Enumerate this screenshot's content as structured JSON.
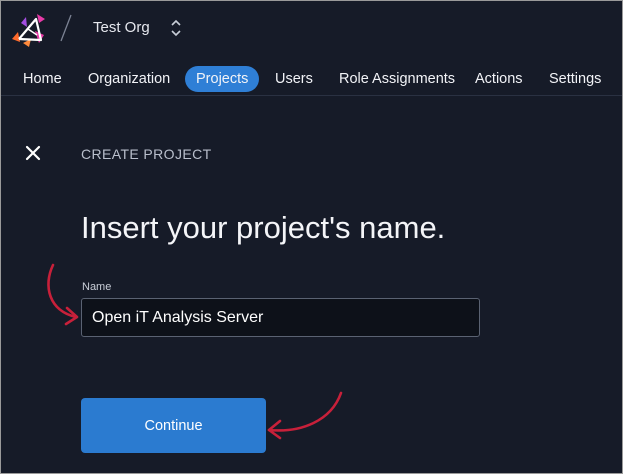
{
  "header": {
    "org_name": "Test Org",
    "brand_colors": [
      "#ff6a2b",
      "#e83aa8",
      "#a34ee0",
      "#ffffff"
    ],
    "icons": [
      "logo-icon",
      "org-switcher-icon"
    ]
  },
  "nav": {
    "items": [
      {
        "label": "Home",
        "active": false
      },
      {
        "label": "Organization",
        "active": false
      },
      {
        "label": "Projects",
        "active": true
      },
      {
        "label": "Users",
        "active": false
      },
      {
        "label": "Role Assignments",
        "active": false
      },
      {
        "label": "Actions",
        "active": false
      },
      {
        "label": "Settings",
        "active": false
      }
    ],
    "active_color": "#2f7fd6"
  },
  "page": {
    "kicker": "CREATE PROJECT",
    "title": "Insert your project's name.",
    "close_icon": "close-icon"
  },
  "form": {
    "name_label": "Name",
    "name_value": "Open iT Analysis Server",
    "continue_label": "Continue",
    "button_color": "#2b7bd0"
  },
  "annotations": {
    "arrow_color": "#c8203a",
    "arrow_count": 2
  }
}
